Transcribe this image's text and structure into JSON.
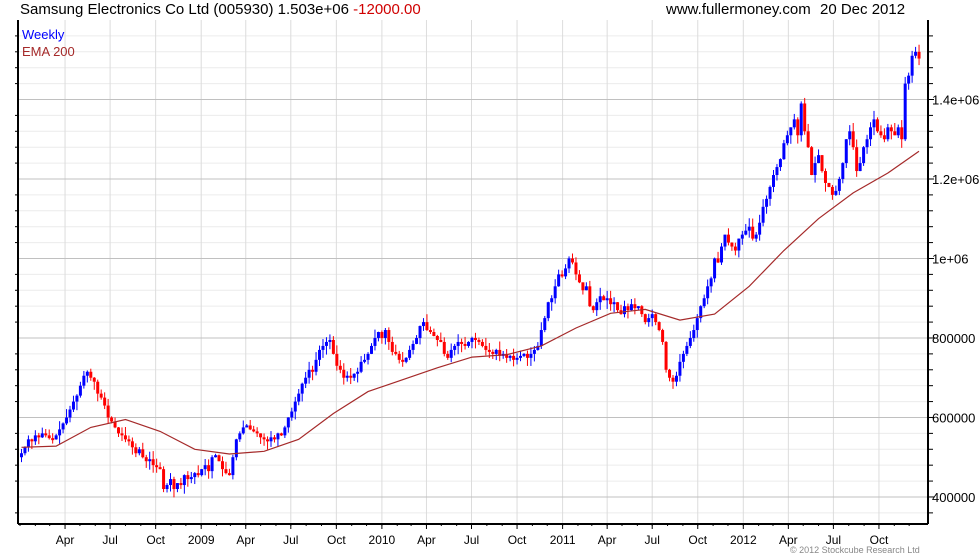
{
  "header": {
    "title": "Samsung Electronics Co Ltd (005930) 1.503e+06",
    "change": "-12000.00",
    "site": "www.fullermoney.com",
    "date": "20 Dec 2012"
  },
  "footer": {
    "copyright": "© 2012 Stockcube Research Ltd"
  },
  "colors": {
    "up": "#0000ff",
    "down": "#ff0000",
    "ema": "#a52a2a",
    "change": "#d00000"
  },
  "chart_data": {
    "type": "candlestick",
    "legend": [
      {
        "label": "Weekly",
        "color": "#0000ff"
      },
      {
        "label": "EMA 200",
        "color": "#a52a2a"
      }
    ],
    "legend_position": "top-left",
    "grid": true,
    "y_axis_side": "right",
    "ylim": [
      332000,
      1600000
    ],
    "y_ticks": [
      {
        "value": 400000,
        "label": "400000"
      },
      {
        "value": 600000,
        "label": "600000"
      },
      {
        "value": 800000,
        "label": "800000"
      },
      {
        "value": 1000000,
        "label": "1e+06"
      },
      {
        "value": 1200000,
        "label": "1.2e+06"
      },
      {
        "value": 1400000,
        "label": "1.4e+06"
      }
    ],
    "x_range": [
      "2008-01-01",
      "2012-12-31"
    ],
    "x_ticks": [
      {
        "date": "2008-04-01",
        "label": "Apr"
      },
      {
        "date": "2008-07-01",
        "label": "Jul"
      },
      {
        "date": "2008-10-01",
        "label": "Oct"
      },
      {
        "date": "2009-01-01",
        "label": "2009"
      },
      {
        "date": "2009-04-01",
        "label": "Apr"
      },
      {
        "date": "2009-07-01",
        "label": "Jul"
      },
      {
        "date": "2009-10-01",
        "label": "Oct"
      },
      {
        "date": "2010-01-01",
        "label": "2010"
      },
      {
        "date": "2010-04-01",
        "label": "Apr"
      },
      {
        "date": "2010-07-01",
        "label": "Jul"
      },
      {
        "date": "2010-10-01",
        "label": "Oct"
      },
      {
        "date": "2011-01-01",
        "label": "2011"
      },
      {
        "date": "2011-04-01",
        "label": "Apr"
      },
      {
        "date": "2011-07-01",
        "label": "Jul"
      },
      {
        "date": "2011-10-01",
        "label": "Oct"
      },
      {
        "date": "2012-01-01",
        "label": "2012"
      },
      {
        "date": "2012-04-01",
        "label": "Apr"
      },
      {
        "date": "2012-07-01",
        "label": "Jul"
      },
      {
        "date": "2012-10-01",
        "label": "Oct"
      }
    ],
    "weekly": {
      "first_week": "2008-01-04",
      "closes": [
        510000,
        525000,
        545000,
        540000,
        555000,
        550000,
        560000,
        555000,
        548000,
        545000,
        555000,
        570000,
        585000,
        600000,
        620000,
        640000,
        655000,
        680000,
        705000,
        715000,
        700000,
        690000,
        660000,
        650000,
        630000,
        600000,
        590000,
        575000,
        560000,
        555000,
        545000,
        540000,
        525000,
        510000,
        520000,
        500000,
        490000,
        495000,
        480000,
        475000,
        470000,
        420000,
        430000,
        445000,
        420000,
        435000,
        430000,
        455000,
        445000,
        450000,
        460000,
        455000,
        470000,
        480000,
        465000,
        500000,
        505000,
        490000,
        470000,
        460000,
        455000,
        500000,
        545000,
        560000,
        575000,
        580000,
        570000,
        565000,
        560000,
        550000,
        545000,
        540000,
        550000,
        545000,
        560000,
        555000,
        575000,
        600000,
        615000,
        640000,
        660000,
        685000,
        700000,
        720000,
        715000,
        745000,
        770000,
        780000,
        790000,
        795000,
        760000,
        730000,
        720000,
        700000,
        705000,
        700000,
        710000,
        715000,
        740000,
        745000,
        760000,
        780000,
        800000,
        815000,
        800000,
        820000,
        790000,
        765000,
        760000,
        745000,
        740000,
        750000,
        770000,
        785000,
        800000,
        830000,
        840000,
        820000,
        815000,
        805000,
        795000,
        790000,
        760000,
        750000,
        770000,
        780000,
        790000,
        785000,
        780000,
        790000,
        800000,
        795000,
        790000,
        780000,
        770000,
        765000,
        760000,
        770000,
        755000,
        760000,
        750000,
        755000,
        745000,
        750000,
        755000,
        760000,
        750000,
        760000,
        770000,
        780000,
        820000,
        850000,
        890000,
        900000,
        930000,
        960000,
        955000,
        975000,
        1000000,
        990000,
        960000,
        940000,
        920000,
        930000,
        880000,
        870000,
        890000,
        905000,
        895000,
        900000,
        885000,
        890000,
        870000,
        860000,
        880000,
        870000,
        885000,
        875000,
        880000,
        860000,
        840000,
        850000,
        860000,
        840000,
        820000,
        790000,
        720000,
        700000,
        690000,
        705000,
        740000,
        760000,
        780000,
        800000,
        820000,
        850000,
        880000,
        900000,
        930000,
        950000,
        1000000,
        990000,
        1030000,
        1060000,
        1040000,
        1030000,
        1020000,
        1050000,
        1060000,
        1070000,
        1080000,
        1050000,
        1060000,
        1090000,
        1130000,
        1150000,
        1180000,
        1210000,
        1230000,
        1250000,
        1290000,
        1310000,
        1330000,
        1350000,
        1310000,
        1390000,
        1320000,
        1280000,
        1210000,
        1240000,
        1260000,
        1220000,
        1190000,
        1180000,
        1160000,
        1170000,
        1200000,
        1240000,
        1300000,
        1320000,
        1280000,
        1220000,
        1240000,
        1280000,
        1300000,
        1330000,
        1350000,
        1320000,
        1310000,
        1300000,
        1330000,
        1320000,
        1310000,
        1330000,
        1300000,
        1440000,
        1460000,
        1510000,
        1520000,
        1503000
      ]
    },
    "ema_200": [
      [
        "2008-01-04",
        525000
      ],
      [
        "2008-03-14",
        528000
      ],
      [
        "2008-05-23",
        575000
      ],
      [
        "2008-08-01",
        595000
      ],
      [
        "2008-10-10",
        565000
      ],
      [
        "2008-12-19",
        520000
      ],
      [
        "2009-02-27",
        508000
      ],
      [
        "2009-05-08",
        515000
      ],
      [
        "2009-07-17",
        545000
      ],
      [
        "2009-09-25",
        610000
      ],
      [
        "2009-12-04",
        665000
      ],
      [
        "2010-02-12",
        695000
      ],
      [
        "2010-04-23",
        725000
      ],
      [
        "2010-07-02",
        752000
      ],
      [
        "2010-09-10",
        758000
      ],
      [
        "2010-11-19",
        780000
      ],
      [
        "2011-01-28",
        825000
      ],
      [
        "2011-04-08",
        862000
      ],
      [
        "2011-06-17",
        872000
      ],
      [
        "2011-08-26",
        845000
      ],
      [
        "2011-11-04",
        860000
      ],
      [
        "2012-01-13",
        930000
      ],
      [
        "2012-03-23",
        1020000
      ],
      [
        "2012-06-01",
        1100000
      ],
      [
        "2012-08-10",
        1165000
      ],
      [
        "2012-10-19",
        1215000
      ],
      [
        "2012-12-21",
        1270000
      ]
    ]
  }
}
